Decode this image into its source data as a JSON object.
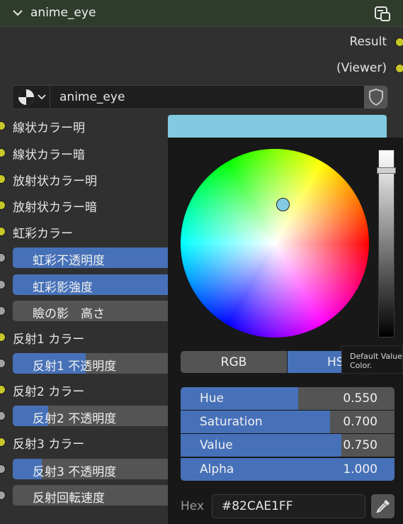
{
  "node": {
    "title": "anime_eye",
    "outputs": [
      {
        "label": "Result"
      },
      {
        "label": "(Viewer)"
      }
    ],
    "node_tree_name": "anime_eye",
    "inputs": [
      {
        "label": "線状カラー明",
        "kind": "color",
        "socket_color": "#c7c729"
      },
      {
        "label": "線状カラー暗",
        "kind": "color",
        "socket_color": "#c7c729"
      },
      {
        "label": "放射状カラー明",
        "kind": "color",
        "socket_color": "#c7c729"
      },
      {
        "label": "放射状カラー暗",
        "kind": "color",
        "socket_color": "#c7c729"
      },
      {
        "label": "虹彩カラー",
        "kind": "color",
        "socket_color": "#c7c729"
      },
      {
        "label": "虹彩不透明度",
        "kind": "slider",
        "socket_color": "#a1a1a1"
      },
      {
        "label": "虹彩影強度",
        "kind": "slider",
        "socket_color": "#a1a1a1"
      },
      {
        "label": "瞼の影　高さ",
        "kind": "slider",
        "socket_color": "#a1a1a1"
      },
      {
        "label": "反射1 カラー",
        "kind": "color",
        "socket_color": "#c7c729"
      },
      {
        "label": "反射1 不透明度",
        "kind": "slider",
        "socket_color": "#a1a1a1"
      },
      {
        "label": "反射2 カラー",
        "kind": "color",
        "socket_color": "#c7c729"
      },
      {
        "label": "反射2 不透明度",
        "kind": "slider",
        "socket_color": "#a1a1a1"
      },
      {
        "label": "反射3 カラー",
        "kind": "color",
        "socket_color": "#c7c729"
      },
      {
        "label": "反射3 不透明度",
        "kind": "slider",
        "socket_color": "#a1a1a1"
      },
      {
        "label": "反射回転速度",
        "kind": "slider",
        "socket_color": "#a1a1a1"
      }
    ]
  },
  "color_picker": {
    "current_color": "#82cae1",
    "modes": [
      "RGB",
      "HSV"
    ],
    "selected_mode": "HSV",
    "mode_hsv_visible_text": "HS",
    "tooltip_text": "Default Value Color.",
    "fields": [
      {
        "label": "Hue",
        "value": "0.550",
        "fraction": 0.55
      },
      {
        "label": "Saturation",
        "value": "0.700",
        "fraction": 0.7
      },
      {
        "label": "Value",
        "value": "0.750",
        "fraction": 0.75
      },
      {
        "label": "Alpha",
        "value": "1.000",
        "fraction": 1.0
      }
    ],
    "hex_label": "Hex",
    "hex_value": "#82CAE1FF"
  },
  "colors": {
    "accent": "#4671b8",
    "header_bg": "#2f3c2c",
    "node_bg": "#303030",
    "color_socket": "#c7c729",
    "float_socket": "#a1a1a1"
  }
}
